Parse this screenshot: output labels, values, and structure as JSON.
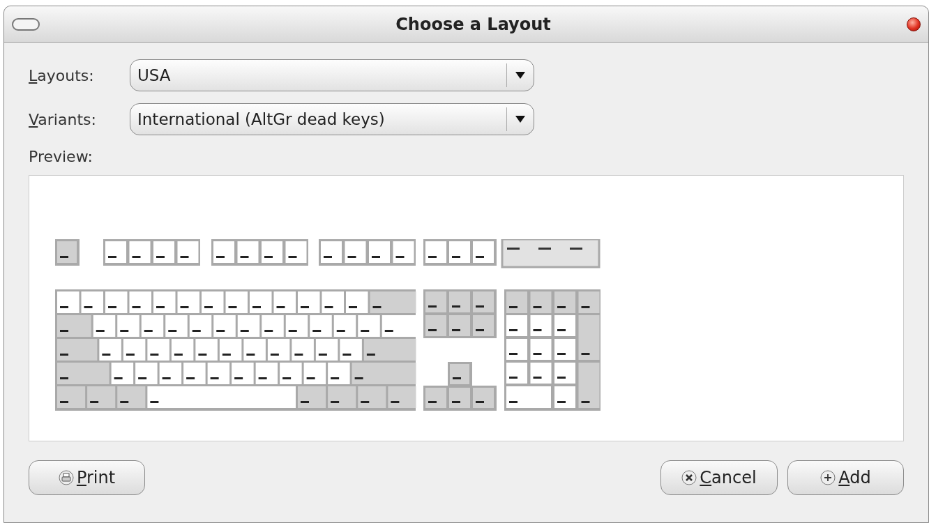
{
  "window": {
    "title": "Choose a Layout"
  },
  "fields": [
    {
      "label": {
        "key": "L",
        "rest": "ayouts:"
      },
      "value": "USA"
    },
    {
      "label": {
        "key": "V",
        "rest": "ariants:"
      },
      "value": "International (AltGr dead keys)"
    }
  ],
  "preview": {
    "label": "Preview:"
  },
  "buttons": [
    {
      "kind": "print",
      "key": "P",
      "rest": "rint"
    },
    {
      "kind": "cancel",
      "key": "C",
      "rest": "ancel"
    },
    {
      "kind": "add",
      "key": "A",
      "rest": "dd"
    }
  ]
}
